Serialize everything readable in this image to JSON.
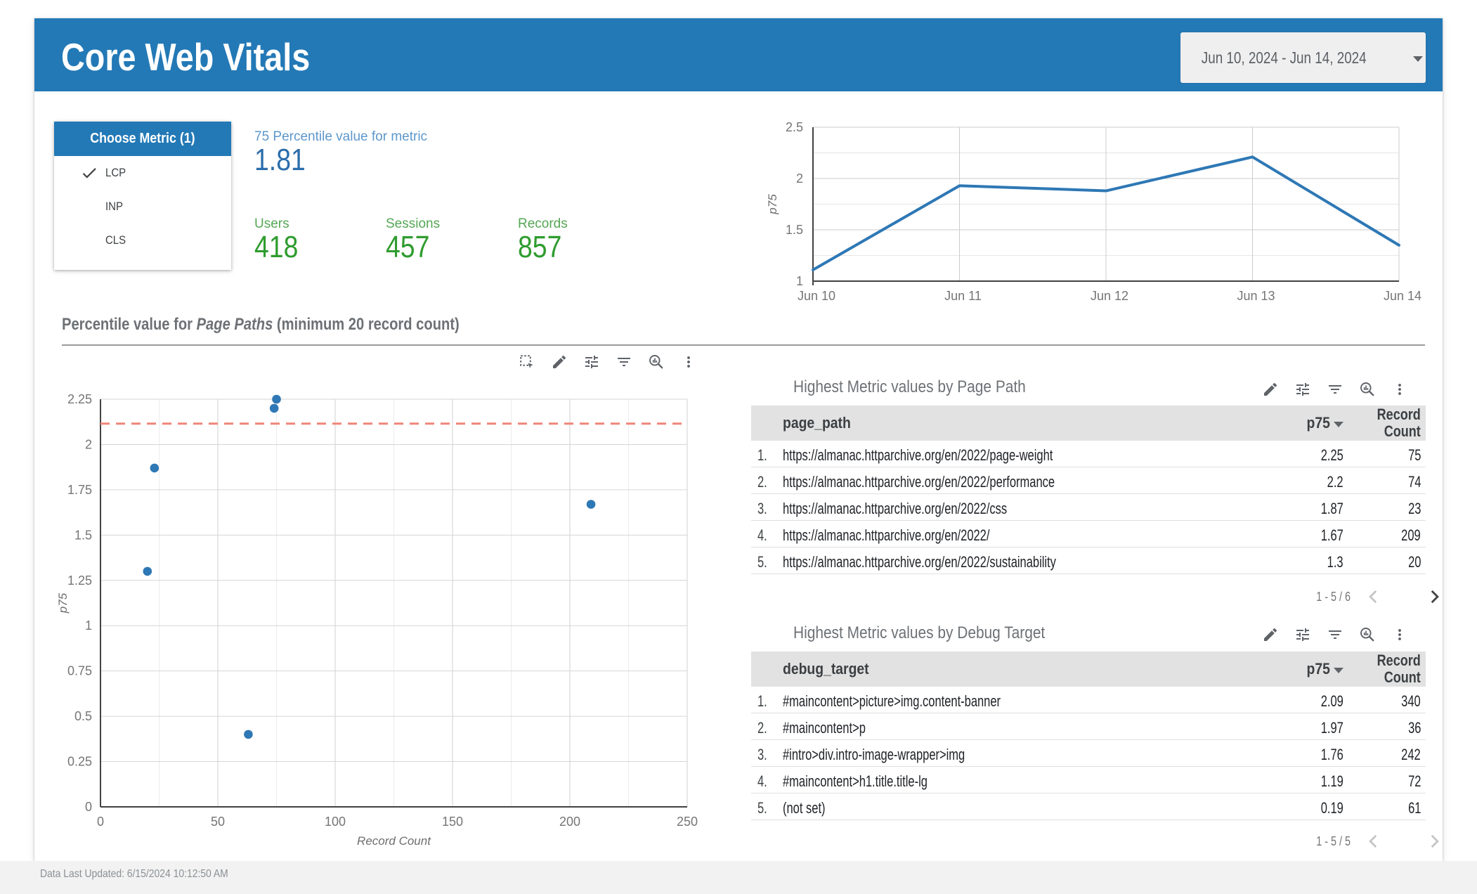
{
  "header": {
    "title": "Core Web Vitals",
    "date_range": "Jun 10, 2024 - Jun 14, 2024",
    "date_picker_icon": "caret-down-icon"
  },
  "metric_selector": {
    "title": "Choose Metric (1)",
    "options": [
      {
        "label": "LCP",
        "selected": true
      },
      {
        "label": "INP",
        "selected": false
      },
      {
        "label": "CLS",
        "selected": false
      }
    ],
    "selected_icon": "check-icon"
  },
  "scorecards": {
    "percentile": {
      "label": "75 Percentile value for metric",
      "value": "1.81"
    },
    "users": {
      "label": "Users",
      "value": "418"
    },
    "sessions": {
      "label": "Sessions",
      "value": "457"
    },
    "records": {
      "label": "Records",
      "value": "857"
    }
  },
  "section": {
    "prefix": "Percentile value for ",
    "italic": "Page Paths",
    "suffix": " (minimum 20 record count)"
  },
  "toolbars": {
    "chart": [
      "box-select-icon",
      "edit-icon",
      "tune-icon",
      "filter-icon",
      "explore-icon",
      "more-vert-icon"
    ],
    "table": [
      "edit-icon",
      "tune-icon",
      "filter-icon",
      "explore-icon",
      "more-vert-icon"
    ]
  },
  "tables": [
    {
      "title": "Highest Metric values by Page Path",
      "columns": [
        "page_path",
        "p75",
        "Record Count"
      ],
      "sorted_by": "p75",
      "rows": [
        [
          "https://almanac.httparchive.org/en/2022/page-weight",
          "2.25",
          "75"
        ],
        [
          "https://almanac.httparchive.org/en/2022/performance",
          "2.2",
          "74"
        ],
        [
          "https://almanac.httparchive.org/en/2022/css",
          "1.87",
          "23"
        ],
        [
          "https://almanac.httparchive.org/en/2022/",
          "1.67",
          "209"
        ],
        [
          "https://almanac.httparchive.org/en/2022/sustainability",
          "1.3",
          "20"
        ]
      ],
      "pagination": "1 - 5 / 6",
      "prev_enabled": false,
      "next_enabled": true
    },
    {
      "title": "Highest Metric values by Debug Target",
      "columns": [
        "debug_target",
        "p75",
        "Record Count"
      ],
      "sorted_by": "p75",
      "rows": [
        [
          "#maincontent>picture>img.content-banner",
          "2.09",
          "340"
        ],
        [
          "#maincontent>p",
          "1.97",
          "36"
        ],
        [
          "#intro>div.intro-image-wrapper>img",
          "1.76",
          "242"
        ],
        [
          "#maincontent>h1.title.title-lg",
          "1.19",
          "72"
        ],
        [
          "(not set)",
          "0.19",
          "61"
        ]
      ],
      "pagination": "1 - 5 / 5",
      "prev_enabled": false,
      "next_enabled": false
    }
  ],
  "footer": {
    "text": "Data Last Updated: 6/15/2024 10:12:50 AM"
  },
  "colors": {
    "header_blue": "#2379b6",
    "chart_blue": "#2e78b5",
    "value_blue": "#2b6dab",
    "label_blue": "#5d97cb",
    "value_green": "#2f9c2f",
    "label_green": "#55a755",
    "reference_red": "#ef8579",
    "table_header_bg": "#e2e2e2",
    "grid_major": "#cccccc",
    "grid_minor": "#e6e6e6",
    "axis_dark": "#424242",
    "tick_gray": "#757575"
  },
  "chart_data": [
    {
      "id": "p75-by-date",
      "type": "line",
      "x": [
        "Jun 10",
        "Jun 11",
        "Jun 12",
        "Jun 13",
        "Jun 14"
      ],
      "series": [
        {
          "name": "p75",
          "values": [
            1.11,
            1.93,
            1.88,
            2.21,
            1.35
          ]
        }
      ],
      "xlabel": "",
      "ylabel": "p75",
      "ylim": [
        1,
        2.5
      ],
      "yticks": [
        1,
        1.5,
        2,
        2.5
      ],
      "yticks_minor": [
        1.25,
        1.75,
        2.25
      ],
      "grid": true,
      "legend": "none"
    },
    {
      "id": "p75-by-record-count",
      "type": "scatter",
      "points": [
        [
          75,
          2.25
        ],
        [
          74,
          2.2
        ],
        [
          23,
          1.87
        ],
        [
          209,
          1.67
        ],
        [
          20,
          1.3
        ],
        [
          63,
          0.4
        ]
      ],
      "xlabel": "Record Count",
      "ylabel": "p75",
      "xlim": [
        0,
        250
      ],
      "ylim": [
        0,
        2.25
      ],
      "xticks": [
        0,
        50,
        100,
        150,
        200,
        250
      ],
      "xticks_minor_step": 25,
      "yticks_step": 0.25,
      "reference_line_y": 2.115,
      "grid": true,
      "legend": "none"
    }
  ]
}
